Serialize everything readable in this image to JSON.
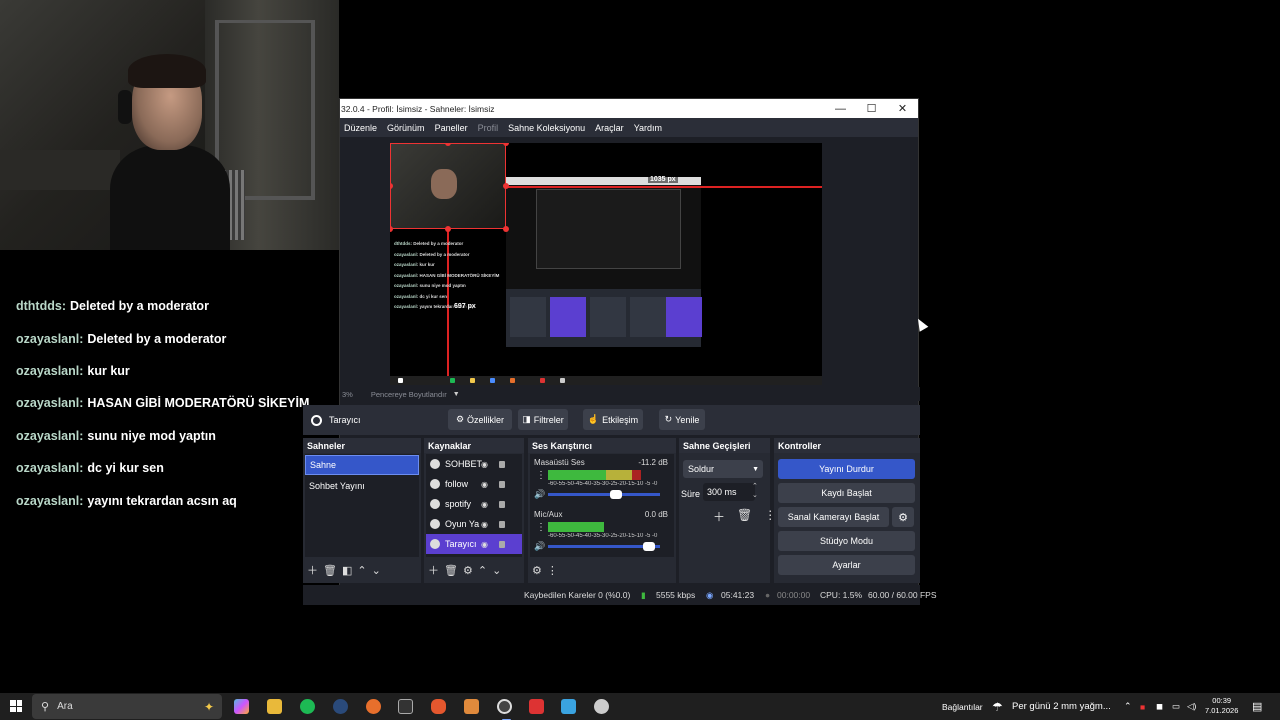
{
  "chat": {
    "lines": [
      {
        "user": "dthtdds",
        "msg": "Deleted by a moderator"
      },
      {
        "user": "ozayaslanl",
        "msg": "Deleted by a moderator"
      },
      {
        "user": "ozayaslanl",
        "msg": "kur kur"
      },
      {
        "user": "ozayaslanl",
        "msg": "HASAN GİBİ MODERATÖRÜ SİKEYİM"
      },
      {
        "user": "ozayaslanl",
        "msg": "sunu niye mod yaptın"
      },
      {
        "user": "ozayaslanl",
        "msg": "dc yi kur sen"
      },
      {
        "user": "ozayaslanl",
        "msg": "yayını tekrardan acsın aq"
      }
    ]
  },
  "obs": {
    "title": "32.0.4 - Profil: İsimsiz - Sahneler: İsimsiz",
    "window_controls": {
      "minimize": "—",
      "maximize": "☐",
      "close": "✕"
    },
    "menu": [
      "Düzenle",
      "Görünüm",
      "Paneller",
      "Profil",
      "Sahne Koleksiyonu",
      "Araçlar",
      "Yardım"
    ],
    "preview_labels": {
      "width": "1035 px",
      "height": "697 px"
    },
    "preview_status": {
      "zoom": "3%",
      "fit": "Pencereye Boyutlandır",
      "caret": "▼"
    },
    "source_toolbar": {
      "source_name": "Tarayıcı",
      "properties": "Özellikler",
      "filters": "Filtreler",
      "interact": "Etkileşim",
      "refresh": "Yenile"
    },
    "scenes": {
      "title": "Sahneler",
      "items": [
        "Sahne",
        "Sohbet Yayını"
      ],
      "active_index": 0
    },
    "sources": {
      "title": "Kaynaklar",
      "items": [
        "SOHBET",
        "follow",
        "spotify",
        "Oyun Ya",
        "Tarayıcı"
      ],
      "active_index": 4
    },
    "mixer": {
      "title": "Ses Karıştırıcı",
      "channels": [
        {
          "name": "Masaüstü Ses",
          "db": "-11.2 dB",
          "level": 0.83,
          "volume": 0.62
        },
        {
          "name": "Mic/Aux",
          "db": "0.0 dB",
          "level": 0.5,
          "volume": 0.95
        }
      ],
      "scale": "-60-55-50-45-40-35-30-25-20-15-10 -5 -0"
    },
    "transitions": {
      "title": "Sahne Geçişleri",
      "selected": "Soldur",
      "duration_label": "Süre",
      "duration_value": "300 ms"
    },
    "controls": {
      "title": "Kontroller",
      "stop_stream": "Yayını Durdur",
      "start_record": "Kaydı Başlat",
      "virtual_cam": "Sanal Kamerayı Başlat",
      "studio_mode": "Stüdyo Modu",
      "settings": "Ayarlar"
    },
    "status": {
      "dropped": "Kaybedilen Kareler 0 (%0.0)",
      "bitrate": "5555 kbps",
      "stream_time": "05:41:23",
      "record_time": "00:00:00",
      "cpu": "CPU: 1.5%",
      "fps": "60.00 / 60.00 FPS"
    }
  },
  "taskbar": {
    "search_placeholder": "Ara",
    "tray": {
      "connections": "Bağlantılar",
      "weather": "Per günü 2 mm yağm...",
      "time": "00:39",
      "date": "7.01.2026"
    }
  },
  "colors": {
    "accent": "#3557c9",
    "source_active": "#5b3fd0",
    "chat_user": "#b9d7c8"
  }
}
